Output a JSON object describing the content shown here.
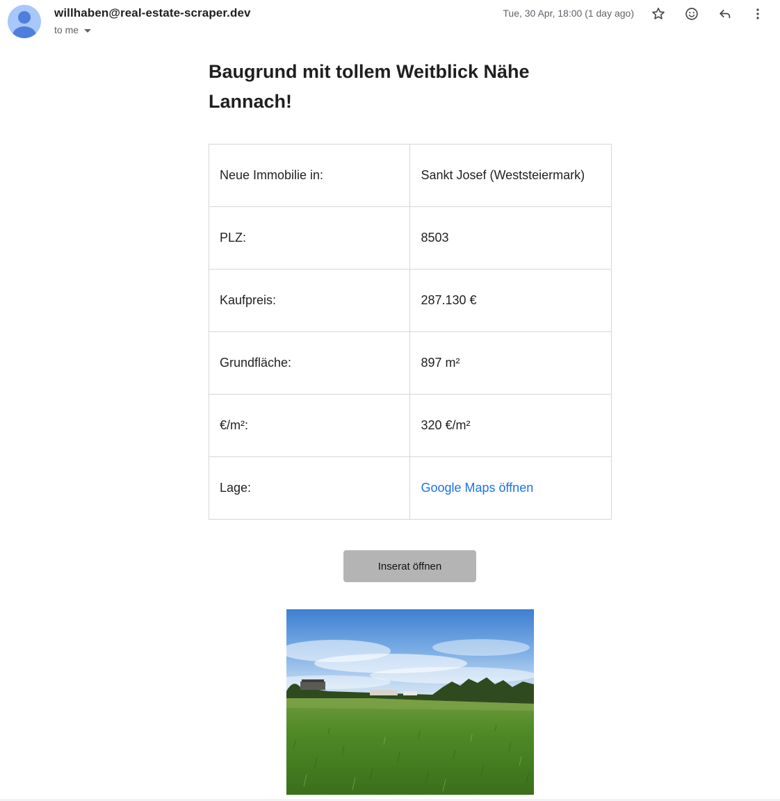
{
  "header": {
    "sender": "willhaben@real-estate-scraper.dev",
    "recipient": "to me",
    "timestamp": "Tue, 30 Apr, 18:00 (1 day ago)",
    "icons": [
      "star-icon",
      "emoji-reaction-icon",
      "reply-icon",
      "more-vert-icon"
    ]
  },
  "email": {
    "subject": "Baugrund mit tollem Weitblick Nähe Lannach!",
    "rows": [
      {
        "label": "Neue Immobilie in:",
        "value": "Sankt Josef (Weststeiermark)"
      },
      {
        "label": "PLZ:",
        "value": "8503"
      },
      {
        "label": "Kaufpreis:",
        "value": "287.130 €"
      },
      {
        "label": "Grundfläche:",
        "value": "897 m²"
      },
      {
        "label": "€/m²:",
        "value": "320 €/m²"
      },
      {
        "label": "Lage:",
        "value": "Google Maps öffnen"
      }
    ],
    "button_label": "Inserat öffnen"
  },
  "colors": {
    "link": "#1a73e8",
    "button_bg": "#b4b4b4",
    "avatar_bg": "#a8c7fa",
    "avatar_fg": "#4f7fdc"
  }
}
